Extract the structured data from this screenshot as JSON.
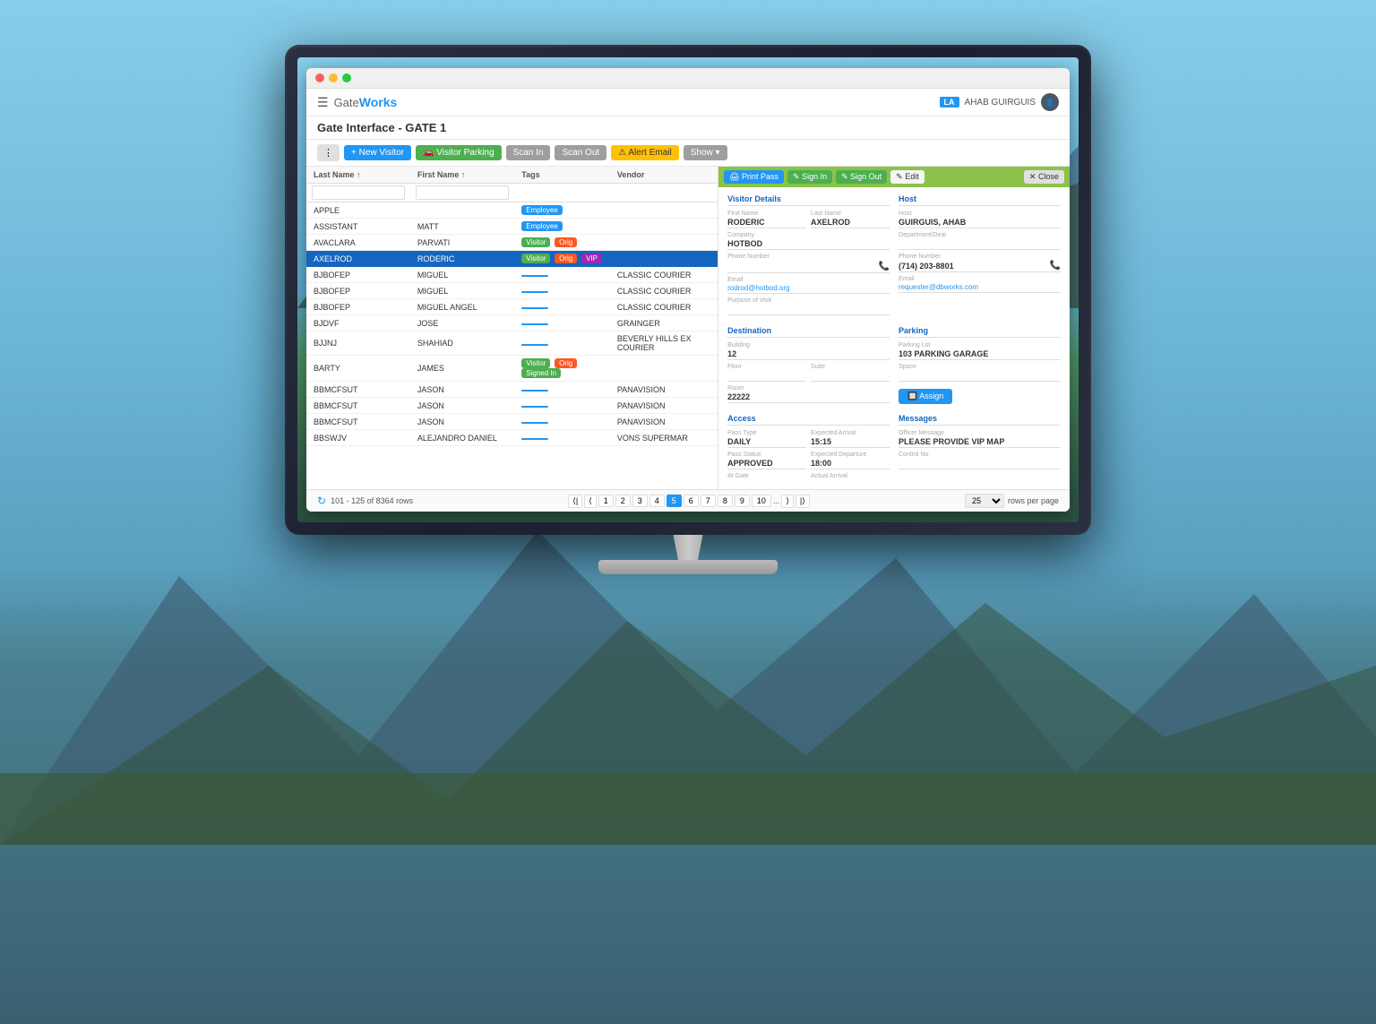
{
  "app": {
    "title": "GateWorks",
    "gate_label": "Gate",
    "works_label": "Works",
    "page_title": "Gate Interface - GATE 1",
    "user_location": "LA",
    "user_name": "AHAB GUIRGUIS"
  },
  "toolbar": {
    "dots_btn": "⋮",
    "new_visitor_btn": "+ New Visitor",
    "visitor_parking_btn": "🚗 Visitor Parking",
    "scan_in_btn": "Scan In",
    "scan_out_btn": "Scan Out",
    "alert_email_btn": "⚠ Alert Email",
    "show_btn": "Show ▾"
  },
  "table": {
    "columns": [
      "Last Name ↑",
      "First Name ↑",
      "Tags",
      "Vendor"
    ],
    "filter_placeholders": [
      "",
      "",
      "",
      ""
    ],
    "rows": [
      {
        "last": "APPLE",
        "first": "",
        "tags": [
          "Employee"
        ],
        "tag_types": [
          "employee"
        ],
        "vendor": ""
      },
      {
        "last": "ASSISTANT",
        "first": "MATT",
        "tags": [
          "Employee"
        ],
        "tag_types": [
          "employee"
        ],
        "vendor": ""
      },
      {
        "last": "AVACLARA",
        "first": "PARVATI",
        "tags": [
          "Visitor",
          "Orig"
        ],
        "tag_types": [
          "visitor",
          "orig"
        ],
        "vendor": ""
      },
      {
        "last": "AXELROD",
        "first": "RODERIC",
        "tags": [
          "Visitor",
          "Orig",
          "VIP"
        ],
        "tag_types": [
          "visitor",
          "orig",
          "vip"
        ],
        "vendor": "",
        "selected": true
      },
      {
        "last": "BJBOFEP",
        "first": "MIGUEL",
        "tags": [
          "blue"
        ],
        "tag_types": [
          "blue"
        ],
        "vendor": "CLASSIC COURIER"
      },
      {
        "last": "BJBOFEP",
        "first": "MIGUEL",
        "tags": [
          "blue"
        ],
        "tag_types": [
          "blue"
        ],
        "vendor": "CLASSIC COURIER"
      },
      {
        "last": "BJBOFEP",
        "first": "MIGUEL ANGEL",
        "tags": [
          "blue"
        ],
        "tag_types": [
          "blue"
        ],
        "vendor": "CLASSIC COURIER"
      },
      {
        "last": "BJDVF",
        "first": "JOSE",
        "tags": [
          "blue"
        ],
        "tag_types": [
          "blue"
        ],
        "vendor": "GRAINGER"
      },
      {
        "last": "BJJNJ",
        "first": "SHAHIAD",
        "tags": [
          "blue"
        ],
        "tag_types": [
          "blue"
        ],
        "vendor": "BEVERLY HILLS EX COURIER"
      },
      {
        "last": "BARTY",
        "first": "JAMES",
        "tags": [
          "Visitor",
          "Orig",
          "Signed In"
        ],
        "tag_types": [
          "visitor",
          "orig",
          "signed-in"
        ],
        "vendor": ""
      },
      {
        "last": "BBMCFSUT",
        "first": "JASON",
        "tags": [
          "blue"
        ],
        "tag_types": [
          "blue"
        ],
        "vendor": "PANAVISION"
      },
      {
        "last": "BBMCFSUT",
        "first": "JASON",
        "tags": [
          "blue"
        ],
        "tag_types": [
          "blue"
        ],
        "vendor": "PANAVISION"
      },
      {
        "last": "BBMCFSUT",
        "first": "JASON",
        "tags": [
          "blue"
        ],
        "tag_types": [
          "blue"
        ],
        "vendor": "PANAVISION"
      },
      {
        "last": "BBSWJV",
        "first": "ALEJANDRO DANIEL",
        "tags": [
          "blue"
        ],
        "tag_types": [
          "blue"
        ],
        "vendor": "VONS SUPERMAR"
      }
    ]
  },
  "pagination": {
    "info": "101 - 125 of 8364 rows",
    "pages": [
      "1",
      "2",
      "3",
      "4",
      "5",
      "6",
      "7",
      "8",
      "9",
      "10",
      "..."
    ],
    "current_page": "5",
    "rows_per_page": "25",
    "rows_per_page_label": "rows per page"
  },
  "detail_panel": {
    "print_pass_btn": "🖨 Print Pass",
    "sign_in_btn": "✎ Sign In",
    "sign_out_btn": "✎ Sign Out",
    "edit_btn": "✎ Edit",
    "close_btn": "✕ Close",
    "visitor_details_title": "Visitor Details",
    "host_title": "Host",
    "destination_title": "Destination",
    "parking_title": "Parking",
    "access_title": "Access",
    "messages_title": "Messages",
    "fields": {
      "first_name_label": "First Name",
      "first_name_value": "RODERIC",
      "last_name_label": "Last Name",
      "last_name_value": "AXELROD",
      "company_label": "Company",
      "company_value": "HOTBOD",
      "phone_label": "Phone Number",
      "phone_value": "",
      "email_label": "Email",
      "email_value": "rodrod@hotbod.org",
      "purpose_label": "Purpose of Visit",
      "purpose_value": "",
      "host_label": "Host",
      "host_value": "GUIRGUIS, AHAB",
      "dept_label": "Department/Deal",
      "dept_value": "",
      "host_phone_label": "Phone Number",
      "host_phone_value": "(714) 203-8801",
      "host_email_label": "Email",
      "host_email_value": "requester@dbworks.com",
      "building_label": "Building",
      "building_value": "12",
      "floor_label": "Floor",
      "floor_value": "",
      "suite_label": "Suite",
      "suite_value": "",
      "room_label": "Room",
      "room_value": "22222",
      "parking_lot_label": "Parking Lot",
      "parking_lot_value": "103 PARKING GARAGE",
      "space_label": "Space",
      "space_value": "",
      "assign_btn": "🔲 Assign",
      "pass_type_label": "Pass Type",
      "pass_type_value": "DAILY",
      "expected_arrival_label": "Expected Arrival",
      "expected_arrival_value": "15:15",
      "pass_status_label": "Pass Status",
      "pass_status_value": "APPROVED",
      "expected_departure_label": "Expected Departure",
      "expected_departure_value": "18:00",
      "at_gate_label": "At Gate",
      "at_gate_value": "",
      "actual_arrival_label": "Actual Arrival",
      "actual_arrival_value": "",
      "officer_message_label": "Officer Message",
      "officer_message_value": "PLEASE PROVIDE VIP MAP",
      "control_no_label": "Control No",
      "control_no_value": ""
    }
  }
}
